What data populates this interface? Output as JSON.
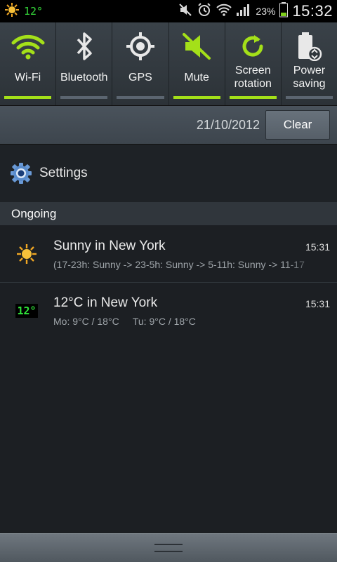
{
  "status_bar": {
    "weather_icon": "sun-icon",
    "temperature": "12°",
    "icons": [
      "mute-icon",
      "alarm-icon",
      "wifi-icon",
      "signal-icon",
      "battery-icon"
    ],
    "battery_percent": "23%",
    "time": "15:32"
  },
  "toggles": [
    {
      "label": "Wi-Fi",
      "icon": "wifi-icon",
      "on": true
    },
    {
      "label": "Bluetooth",
      "icon": "bluetooth-icon",
      "on": false
    },
    {
      "label": "GPS",
      "icon": "gps-icon",
      "on": false
    },
    {
      "label": "Mute",
      "icon": "mute-icon",
      "on": true
    },
    {
      "label": "Screen rotation",
      "icon": "rotation-icon",
      "on": true
    },
    {
      "label": "Power saving",
      "icon": "power-saving-icon",
      "on": false
    }
  ],
  "date_bar": {
    "date": "21/10/2012",
    "clear_label": "Clear"
  },
  "settings": {
    "label": "Settings",
    "icon": "settings-gear-icon"
  },
  "ongoing": {
    "header": "Ongoing"
  },
  "notifications": [
    {
      "icon": "sun-icon",
      "title": "Sunny in New York",
      "subtitle": "(17-23h: Sunny -> 23-5h: Sunny -> 5-11h: Sunny -> 11-17",
      "time": "15:31"
    },
    {
      "icon": "temperature-display-icon",
      "icon_text": "12°",
      "title": "12°C in New York",
      "subtitle": "Mo: 9°C / 18°C     Tu: 9°C / 18°C",
      "time": "15:31"
    }
  ],
  "colors": {
    "toggle_on": "#a4e019",
    "toggle_off": "#5b6570",
    "temp_green": "#35d93a",
    "background": "#1c1f23"
  }
}
